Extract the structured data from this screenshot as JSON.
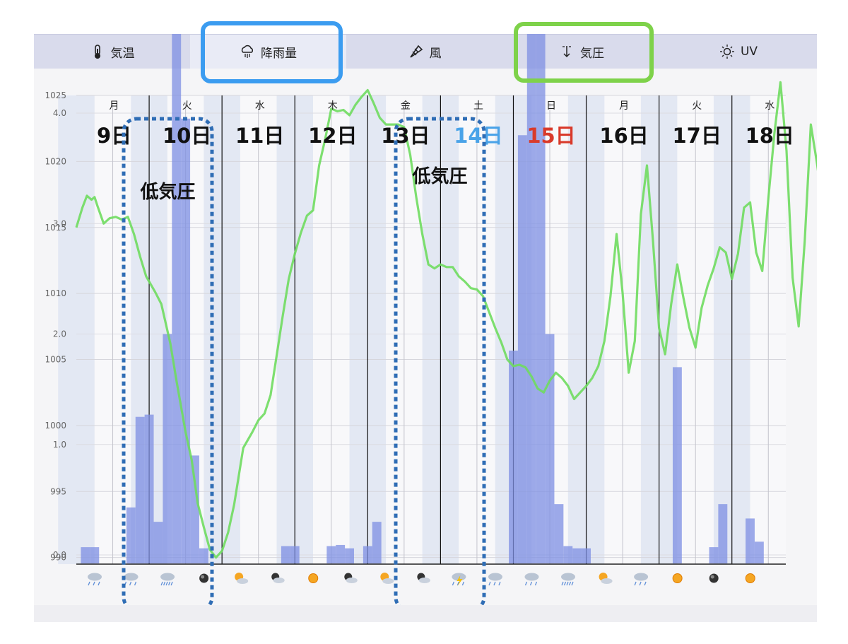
{
  "tabs": [
    {
      "id": "temp",
      "label": "気温",
      "icon": "thermometer-icon"
    },
    {
      "id": "rain",
      "label": "降雨量",
      "icon": "rain-cloud-icon"
    },
    {
      "id": "wind",
      "label": "風",
      "icon": "windsock-icon"
    },
    {
      "id": "pressure",
      "label": "気圧",
      "icon": "pressure-arrow-icon"
    },
    {
      "id": "uv",
      "label": "UV",
      "icon": "sun-icon"
    }
  ],
  "highlight_colors": {
    "rain_tab": "#3b9cf0",
    "pressure_tab": "#7ed24a",
    "low_pressure_box": "#2f6db5"
  },
  "days": [
    {
      "weekday": "月",
      "date": "9日",
      "date_color": "#111111"
    },
    {
      "weekday": "火",
      "date": "10日",
      "date_color": "#111111"
    },
    {
      "weekday": "水",
      "date": "11日",
      "date_color": "#111111"
    },
    {
      "weekday": "木",
      "date": "12日",
      "date_color": "#111111"
    },
    {
      "weekday": "金",
      "date": "13日",
      "date_color": "#111111"
    },
    {
      "weekday": "土",
      "date": "14日",
      "date_color": "#4aa3e8"
    },
    {
      "weekday": "日",
      "date": "15日",
      "date_color": "#d93a2b"
    },
    {
      "weekday": "月",
      "date": "16日",
      "date_color": "#111111"
    },
    {
      "weekday": "火",
      "date": "17日",
      "date_color": "#111111"
    },
    {
      "weekday": "水",
      "date": "18日",
      "date_color": "#111111"
    }
  ],
  "annotations": [
    {
      "text": "低気圧",
      "day_index": 1
    },
    {
      "text": "低気圧",
      "day_index": 5
    }
  ],
  "weather_icons": [
    "cloud-rain",
    "cloud-rain",
    "cloud-heavy-rain",
    "moon",
    "sun-cloud",
    "moon-cloud",
    "sun",
    "moon-cloud",
    "sun-cloud",
    "moon-cloud",
    "thunder-rain",
    "cloud-rain",
    "cloud-rain",
    "cloud-heavy-rain",
    "sun-cloud",
    "cloud-rain",
    "sun",
    "moon",
    "sun"
  ],
  "chart_data": {
    "type": "line+bar",
    "x_unit": "hours from 00:00 on 9日",
    "pressure_axis": {
      "ticks": [
        990,
        995,
        1000,
        1005,
        1010,
        1015,
        1020
      ],
      "top_label": "1025",
      "ylim": [
        989.5,
        1025
      ]
    },
    "rain_axis": {
      "ticks": [
        "0.0",
        "1.0",
        "2.0",
        "3.0",
        "4.0"
      ],
      "ylim": [
        0,
        4
      ]
    },
    "series": [
      {
        "name": "気圧",
        "kind": "line",
        "color": "#6fdc5f",
        "points": [
          [
            0,
            1015
          ],
          [
            2,
            1016.5
          ],
          [
            3.5,
            1017.4
          ],
          [
            5,
            1017.1
          ],
          [
            6,
            1017.3
          ],
          [
            7,
            1016.6
          ],
          [
            9,
            1015.3
          ],
          [
            11,
            1015.7
          ],
          [
            13,
            1015.8
          ],
          [
            15,
            1015.6
          ],
          [
            17,
            1015.8
          ],
          [
            19,
            1014.5
          ],
          [
            21,
            1012.8
          ],
          [
            23,
            1011.3
          ],
          [
            26,
            1010.1
          ],
          [
            28,
            1009.2
          ],
          [
            31,
            1006.2
          ],
          [
            33,
            1003.4
          ],
          [
            36,
            999.5
          ],
          [
            38,
            997.4
          ],
          [
            40,
            994.1
          ],
          [
            42,
            992.3
          ],
          [
            44,
            990.6
          ],
          [
            46,
            990.0
          ],
          [
            48,
            990.5
          ],
          [
            50,
            991.9
          ],
          [
            52,
            994.0
          ],
          [
            55,
            998.3
          ],
          [
            58,
            999.5
          ],
          [
            60,
            1000.4
          ],
          [
            62,
            1000.9
          ],
          [
            64,
            1002.3
          ],
          [
            66,
            1005.3
          ],
          [
            68,
            1008.3
          ],
          [
            70,
            1011.1
          ],
          [
            72,
            1013.0
          ],
          [
            74,
            1014.6
          ],
          [
            76,
            1015.9
          ],
          [
            78,
            1016.3
          ],
          [
            80,
            1019.7
          ],
          [
            82,
            1021.7
          ],
          [
            84,
            1024.0
          ],
          [
            86,
            1023.8
          ],
          [
            88,
            1023.9
          ],
          [
            90,
            1023.5
          ],
          [
            92,
            1024.3
          ],
          [
            94,
            1024.9
          ],
          [
            96,
            1025.4
          ],
          [
            98,
            1024.4
          ],
          [
            100,
            1023.3
          ],
          [
            102,
            1022.8
          ],
          [
            104,
            1022.8
          ],
          [
            106,
            1022.8
          ],
          [
            108,
            1022.6
          ],
          [
            110,
            1020.5
          ],
          [
            112,
            1017.3
          ],
          [
            114,
            1014.5
          ],
          [
            116,
            1012.2
          ],
          [
            118,
            1011.9
          ],
          [
            120,
            1012.2
          ],
          [
            122,
            1012.0
          ],
          [
            124,
            1012.0
          ],
          [
            126,
            1011.3
          ],
          [
            128,
            1010.9
          ],
          [
            130,
            1010.4
          ],
          [
            132,
            1010.3
          ],
          [
            134,
            1009.8
          ],
          [
            136,
            1008.6
          ],
          [
            138,
            1007.4
          ],
          [
            140,
            1006.3
          ],
          [
            142,
            1005.0
          ],
          [
            144,
            1004.5
          ],
          [
            146,
            1004.6
          ],
          [
            148,
            1004.4
          ],
          [
            150,
            1003.7
          ],
          [
            152,
            1002.8
          ],
          [
            154,
            1002.5
          ],
          [
            156,
            1003.4
          ],
          [
            158,
            1004.0
          ],
          [
            160,
            1003.6
          ],
          [
            162,
            1003.0
          ],
          [
            164,
            1002.0
          ],
          [
            166,
            1002.5
          ],
          [
            168,
            1003.0
          ],
          [
            170,
            1003.6
          ],
          [
            172,
            1004.5
          ],
          [
            174,
            1006.4
          ],
          [
            176,
            1009.8
          ],
          [
            178,
            1014.5
          ],
          [
            180,
            1010.0
          ],
          [
            182,
            1004.0
          ],
          [
            184,
            1006.4
          ],
          [
            186,
            1016.0
          ],
          [
            188,
            1019.7
          ],
          [
            190,
            1014.0
          ],
          [
            192,
            1007.4
          ],
          [
            194,
            1005.4
          ],
          [
            196,
            1009.2
          ],
          [
            198,
            1012.2
          ],
          [
            200,
            1009.7
          ],
          [
            202,
            1007.4
          ],
          [
            204,
            1005.9
          ],
          [
            206,
            1008.9
          ],
          [
            208,
            1010.6
          ],
          [
            210,
            1011.9
          ],
          [
            212,
            1013.5
          ],
          [
            214,
            1013.1
          ],
          [
            216,
            1011.1
          ],
          [
            218,
            1013.0
          ],
          [
            220,
            1016.5
          ],
          [
            222,
            1016.9
          ],
          [
            224,
            1013.1
          ],
          [
            226,
            1011.7
          ],
          [
            228,
            1017.2
          ],
          [
            230,
            1022.1
          ],
          [
            232,
            1026.0
          ],
          [
            234,
            1020.8
          ],
          [
            236,
            1011.2
          ],
          [
            238,
            1007.5
          ],
          [
            240,
            1014.0
          ],
          [
            242,
            1022.8
          ],
          [
            244,
            1019.9
          ],
          [
            246,
            1016.5
          ],
          [
            248,
            1020.8
          ],
          [
            250,
            1021.3
          ],
          [
            252,
            1025.6
          ],
          [
            254,
            1021.9
          ],
          [
            256,
            1016.8
          ],
          [
            258,
            1021.6
          ],
          [
            260,
            1022.1
          ],
          [
            262,
            1018.0
          ],
          [
            264,
            1017.2
          ],
          [
            266,
            1015.4
          ],
          [
            268,
            1017.3
          ],
          [
            270,
            1021.1
          ],
          [
            272,
            1019.6
          ],
          [
            274,
            1015.6
          ],
          [
            276,
            1012.1
          ],
          [
            278,
            1007.8
          ],
          [
            280,
            1010.8
          ],
          [
            282,
            1012.7
          ],
          [
            284,
            1012.9
          ],
          [
            286,
            1013.7
          ],
          [
            288,
            1011.4
          ],
          [
            290,
            1008.4
          ],
          [
            292,
            1006.2
          ],
          [
            294,
            1005.2
          ]
        ]
      },
      {
        "name": "降雨量",
        "kind": "bar",
        "bar_width_hours": 3,
        "points": [
          [
            3,
            0.07
          ],
          [
            6,
            0.07
          ],
          [
            18,
            0.43
          ],
          [
            21,
            1.25
          ],
          [
            24,
            1.27
          ],
          [
            27,
            0.3
          ],
          [
            30,
            2.0
          ],
          [
            33,
            5.1
          ],
          [
            36,
            3.95
          ],
          [
            39,
            0.9
          ],
          [
            42,
            0.06
          ],
          [
            69,
            0.08
          ],
          [
            72,
            0.08
          ],
          [
            84,
            0.08
          ],
          [
            87,
            0.09
          ],
          [
            90,
            0.06
          ],
          [
            96,
            0.08
          ],
          [
            99,
            0.3
          ],
          [
            144,
            1.85
          ],
          [
            147,
            3.8
          ],
          [
            150,
            6.7
          ],
          [
            153,
            9.0
          ],
          [
            156,
            2.0
          ],
          [
            159,
            0.46
          ],
          [
            162,
            0.08
          ],
          [
            165,
            0.06
          ],
          [
            168,
            0.06
          ],
          [
            198,
            1.7
          ],
          [
            210,
            0.07
          ],
          [
            213,
            0.46
          ],
          [
            222,
            0.33
          ],
          [
            225,
            0.12
          ],
          [
            276,
            0.07
          ],
          [
            282,
            0.6
          ]
        ]
      }
    ]
  }
}
